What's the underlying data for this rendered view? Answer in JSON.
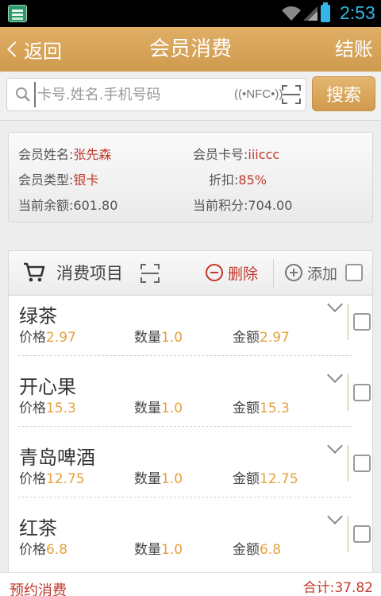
{
  "status_bar": {
    "time": "2:53"
  },
  "titlebar": {
    "back_label": "返回",
    "title": "会员消费",
    "checkout_label": "结账"
  },
  "search": {
    "placeholder": "卡号.姓名.手机号码",
    "nfc_label": "((•NFC•))",
    "button_label": "搜索"
  },
  "member": {
    "name_label": "会员姓名:",
    "name": "张先森",
    "card_label": "会员卡号:",
    "card": "iiiccc",
    "type_label": "会员类型:",
    "type": "银卡",
    "discount_label": "折扣:",
    "discount": "85%",
    "balance_label": "当前余额:",
    "balance": "601.80",
    "points_label": "当前积分:",
    "points": "704.00"
  },
  "section": {
    "title": "消费项目",
    "delete_label": "删除",
    "add_label": "添加"
  },
  "item_labels": {
    "price": "价格",
    "qty": "数量",
    "amount": "金额"
  },
  "items": [
    {
      "name": "绿茶",
      "price": "2.97",
      "qty": "1.0",
      "amount": "2.97"
    },
    {
      "name": "开心果",
      "price": "15.3",
      "qty": "1.0",
      "amount": "15.3"
    },
    {
      "name": "青岛啤酒",
      "price": "12.75",
      "qty": "1.0",
      "amount": "12.75"
    },
    {
      "name": "红茶",
      "price": "6.8",
      "qty": "1.0",
      "amount": "6.8"
    }
  ],
  "footer": {
    "reserve_label": "预约消费",
    "total": "合计:37.82"
  },
  "colors": {
    "accent": "#d9a45a",
    "danger": "#c0392b",
    "number": "#e6a23c",
    "status_blue": "#33b5e5"
  }
}
